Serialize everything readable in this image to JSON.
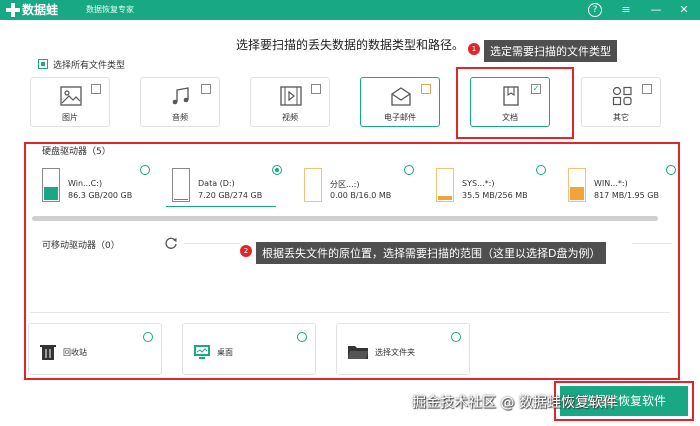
{
  "app": {
    "name": "数据蛙",
    "subtitle": "数据恢复专家"
  },
  "window_buttons": {
    "help": "?",
    "menu": "≡",
    "minimize": "—",
    "close": "✕"
  },
  "heading": "选择要扫描的丢失数据的数据类型和路径。",
  "callouts": [
    {
      "number": "1",
      "text": "选定需要扫描的文件类型"
    },
    {
      "number": "2",
      "text": "根据丢失文件的原位置，选择需要扫描的范围（这里以选择D盘为例）"
    }
  ],
  "select_all_label": "选择所有文件类型",
  "file_types": [
    {
      "label": "图片",
      "icon": "image-icon",
      "checked": false
    },
    {
      "label": "音频",
      "icon": "music-icon",
      "checked": false
    },
    {
      "label": "视频",
      "icon": "video-icon",
      "checked": false
    },
    {
      "label": "电子邮件",
      "icon": "email-icon",
      "checked": false
    },
    {
      "label": "文档",
      "icon": "document-icon",
      "checked": true,
      "check_mark": "✓"
    },
    {
      "label": "其它",
      "icon": "other-icon",
      "checked": false
    }
  ],
  "hard_drives": {
    "title": "硬盘驱动器（5）",
    "items": [
      {
        "label": "Win...C:)",
        "size": "86.3 GB/200 GB",
        "fill": 0.43,
        "color": "#18a884",
        "selected": false
      },
      {
        "label": "Data (D:)",
        "size": "7.20 GB/274 GB",
        "fill": 0.03,
        "color": "#18a884",
        "selected": true
      },
      {
        "label": "分区...:)",
        "size": "0.00  B/16.0 MB",
        "fill": 0.0,
        "color": "#f2a33a",
        "selected": false
      },
      {
        "label": "SYS...*:)",
        "size": "35.5 MB/256 MB",
        "fill": 0.14,
        "color": "#f2a33a",
        "selected": false
      },
      {
        "label": "WIN...*:)",
        "size": "817 MB/1.95 GB",
        "fill": 0.42,
        "color": "#f2a33a",
        "selected": false
      }
    ]
  },
  "removable": {
    "title": "可移动驱动器（0）"
  },
  "locations": [
    {
      "label": "回收站",
      "icon": "recycle-bin-icon"
    },
    {
      "label": "桌面",
      "icon": "desktop-icon"
    },
    {
      "label": "选择文件夹",
      "icon": "folder-icon"
    }
  ],
  "scan_button_label": "数据蛙恢复软件",
  "watermark_text": "掘金技术社区 @ 数据蛙恢复软件",
  "colors": {
    "brand": "#18a884",
    "alert": "#e0262a",
    "callout_bg": "#4f4f4f"
  }
}
